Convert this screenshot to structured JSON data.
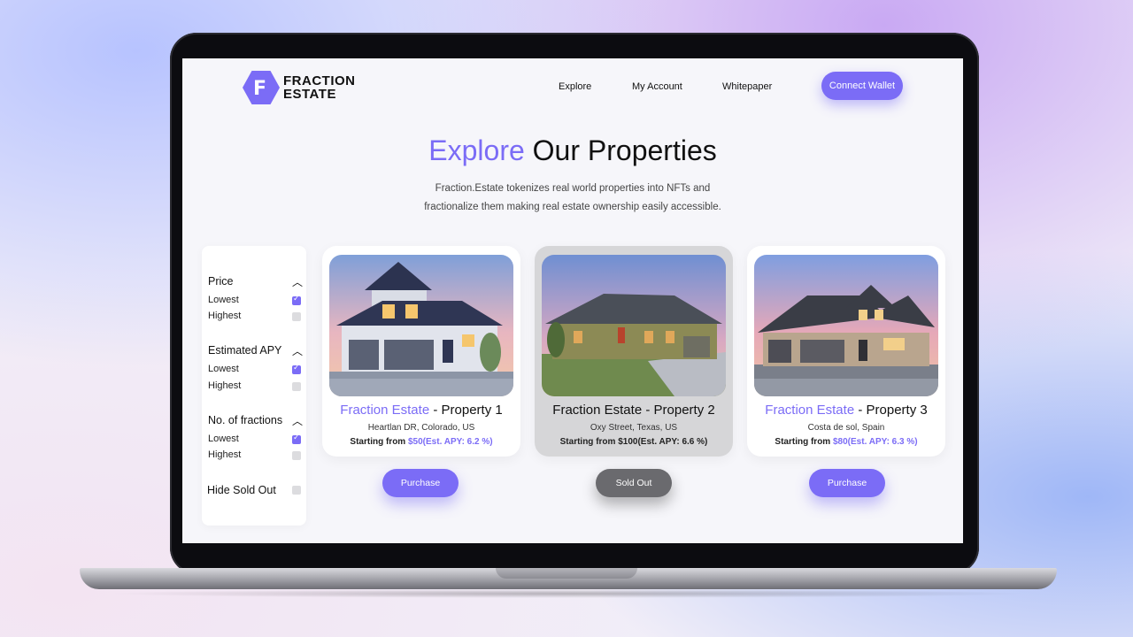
{
  "brand": {
    "line1": "FRACTION",
    "line2": "ESTATE",
    "mark": "F",
    "color": "#7b6cf6"
  },
  "nav": {
    "explore": "Explore",
    "account": "My Account",
    "whitepaper": "Whitepaper",
    "connect": "Connect Wallet"
  },
  "hero": {
    "title_accent": "Explore",
    "title_rest": "Our Properties",
    "subtitle_line1": "Fraction.Estate tokenizes real world properties into NFTs and",
    "subtitle_line2": "fractionalize them making real estate ownership easily accessible."
  },
  "filters": {
    "price": {
      "label": "Price",
      "lowest": "Lowest",
      "highest": "Highest",
      "lowest_checked": true,
      "highest_checked": false
    },
    "apy": {
      "label": "Estimated APY",
      "lowest": "Lowest",
      "highest": "Highest",
      "lowest_checked": true,
      "highest_checked": false
    },
    "fractions": {
      "label": "No. of fractions",
      "lowest": "Lowest",
      "highest": "Highest",
      "lowest_checked": true,
      "highest_checked": false
    },
    "hide_sold": {
      "label": "Hide Sold Out",
      "checked": false
    }
  },
  "properties": [
    {
      "brand": "Fraction Estate",
      "name": "- Property 1",
      "location": "Heartlan DR, Colorado, US",
      "price_prefix": "Starting from",
      "price": "$50",
      "apy": "(Est. APY: 6.2 %)",
      "action": "Purchase",
      "sold_out": false
    },
    {
      "brand": "Fraction Estate",
      "name": "- Property 2",
      "location": "Oxy Street, Texas, US",
      "price_prefix": "Starting from",
      "price": "$100",
      "apy": "(Est. APY: 6.6 %)",
      "action": "Sold Out",
      "sold_out": true
    },
    {
      "brand": "Fraction Estate",
      "name": "- Property 3",
      "location": "Costa de sol, Spain",
      "price_prefix": "Starting from",
      "price": "$80",
      "apy": "(Est. APY: 6.3 %)",
      "action": "Purchase",
      "sold_out": false
    }
  ]
}
